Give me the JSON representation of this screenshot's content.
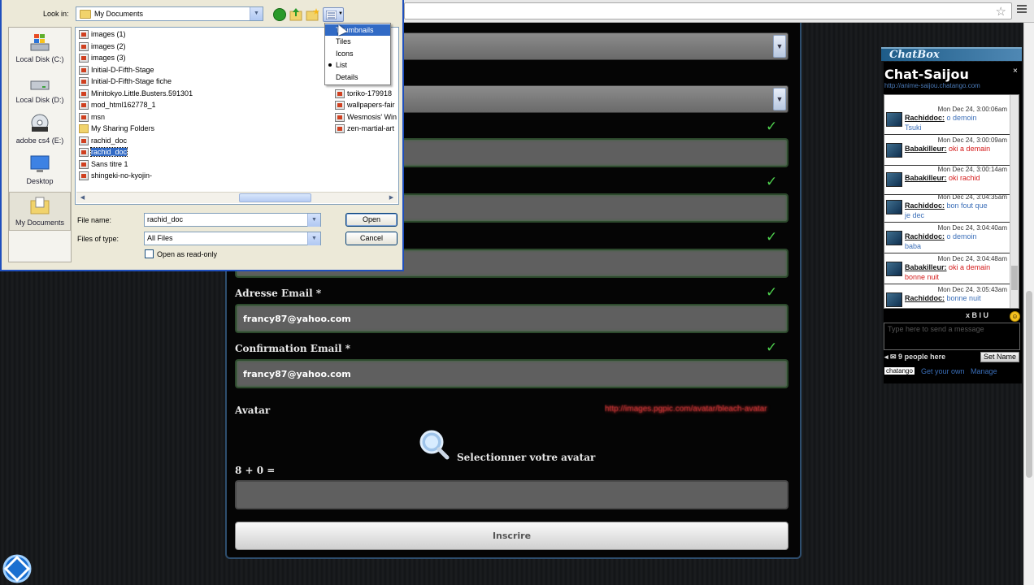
{
  "browser": {
    "star_glyph": "☆"
  },
  "form": {
    "email_label": "Adresse Email *",
    "email_value": "francy87@yahoo.com",
    "confirm_label": "Confirmation Email *",
    "confirm_value": "francy87@yahoo.com",
    "avatar_label": "Avatar",
    "avatar_link": "http://images.pgpic.com/avatar/bleach-avatar",
    "avatar_select": "Selectionner votre avatar",
    "captcha_label": "8 + 0 =",
    "submit_label": "Inscrire",
    "check_glyph": "✓"
  },
  "chat": {
    "header_label": "ChatBox",
    "title": "Chat-Saijou",
    "close_glyph": "×",
    "url": "http://anime-saijou.chatango.com",
    "messages": [
      {
        "time": "Mon Dec 24, 3:00:06am",
        "user": "Rachiddoc:",
        "text": "o demoin",
        "line2": "Tsuki",
        "color": "blue"
      },
      {
        "time": "Mon Dec 24, 3:00:09am",
        "user": "Babakilleur:",
        "text": "oki a demain",
        "line2": "",
        "color": "red"
      },
      {
        "time": "Mon Dec 24, 3:00:14am",
        "user": "Babakilleur:",
        "text": "oki rachid",
        "line2": "",
        "color": "red"
      },
      {
        "time": "Mon Dec 24, 3:04:35am",
        "user": "Rachiddoc:",
        "text": "bon fout que",
        "line2": "je dec",
        "color": "blue"
      },
      {
        "time": "Mon Dec 24, 3:04:40am",
        "user": "Rachiddoc:",
        "text": "o demoin",
        "line2": "baba",
        "color": "blue"
      },
      {
        "time": "Mon Dec 24, 3:04:48am",
        "user": "Babakilleur:",
        "text": "oki a demain",
        "line2": "bonne nuit",
        "color": "red"
      },
      {
        "time": "Mon Dec 24, 3:05:43am",
        "user": "Rachiddoc:",
        "text": "bonne nuit",
        "line2": "",
        "color": "blue"
      }
    ],
    "toolbar_text": "x  B  I  U",
    "input_placeholder": "Type here to send a message",
    "people_text": "◂ ✉ 9 people here",
    "set_name_label": "Set Name",
    "badge_label": "chatango",
    "get_own_label": "Get your own",
    "manage_label": "Manage"
  },
  "dialog": {
    "look_in_label": "Look in:",
    "look_in_value": "My Documents",
    "places": [
      "Local Disk (C:)",
      "Local Disk (D:)",
      "adobe cs4 (E:)",
      "Desktop",
      "My Documents"
    ],
    "files_col1": [
      {
        "name": "images (1)",
        "icon": "doc"
      },
      {
        "name": "images (2)",
        "icon": "doc"
      },
      {
        "name": "images (3)",
        "icon": "doc"
      },
      {
        "name": "Initial-D-Fifth-Stage",
        "icon": "doc"
      },
      {
        "name": "Initial-D-Fifth-Stage fiche",
        "icon": "doc"
      },
      {
        "name": "Minitokyo.Little.Busters.591301",
        "icon": "doc"
      },
      {
        "name": "mod_html162778_1",
        "icon": "doc"
      },
      {
        "name": "msn",
        "icon": "doc"
      },
      {
        "name": "My Sharing Folders",
        "icon": "folder"
      },
      {
        "name": "rachid_doc",
        "icon": "doc"
      },
      {
        "name": "rachid_doc",
        "icon": "doc",
        "selected": true
      },
      {
        "name": "Sans titre 1",
        "icon": "doc"
      },
      {
        "name": "shingeki-no-kyojin-",
        "icon": "doc"
      }
    ],
    "files_col2": [
      {
        "name": "toriko-179918",
        "icon": "doc"
      },
      {
        "name": "wallpapers-fair",
        "icon": "doc"
      },
      {
        "name": "Wesmosis' Win",
        "icon": "doc"
      },
      {
        "name": "zen-martial-art",
        "icon": "doc"
      }
    ],
    "file_name_label": "File name:",
    "file_name_value": "rachid_doc",
    "file_type_label": "Files of type:",
    "file_type_value": "All Files",
    "open_label": "Open",
    "cancel_label": "Cancel",
    "readonly_label": "Open as read-only",
    "view_menu": [
      "Thumbnails",
      "Tiles",
      "Icons",
      "List",
      "Details"
    ],
    "view_selected": "List"
  }
}
